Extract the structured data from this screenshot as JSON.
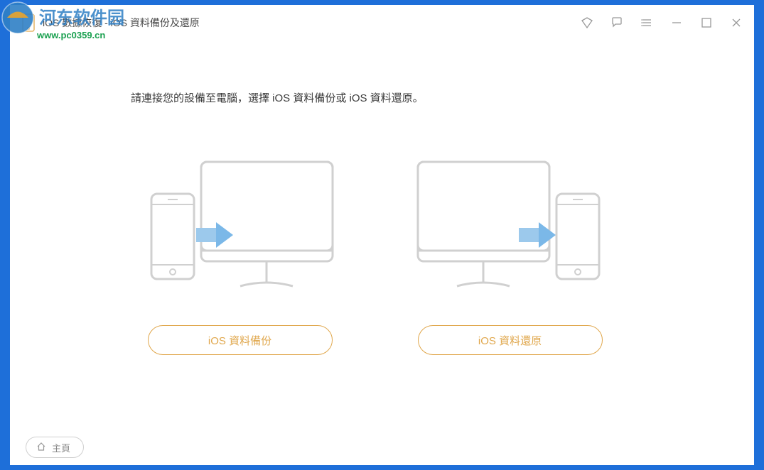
{
  "titlebar": {
    "app_title": "iOS 數據恢復 - iOS 資料備份及還原"
  },
  "watermark": {
    "url": "www.pc0359.cn",
    "logo_text": "河东软件园"
  },
  "main": {
    "instruction": "請連接您的設備至電腦，選擇 iOS 資料備份或 iOS 資料還原。",
    "options": [
      {
        "label": "iOS 資料備份"
      },
      {
        "label": "iOS 資料還原"
      }
    ]
  },
  "bottom": {
    "home_label": "主頁"
  },
  "colors": {
    "accent": "#e0a74c",
    "arrow": "#7bb8e8",
    "outline": "#d0d0d0"
  }
}
